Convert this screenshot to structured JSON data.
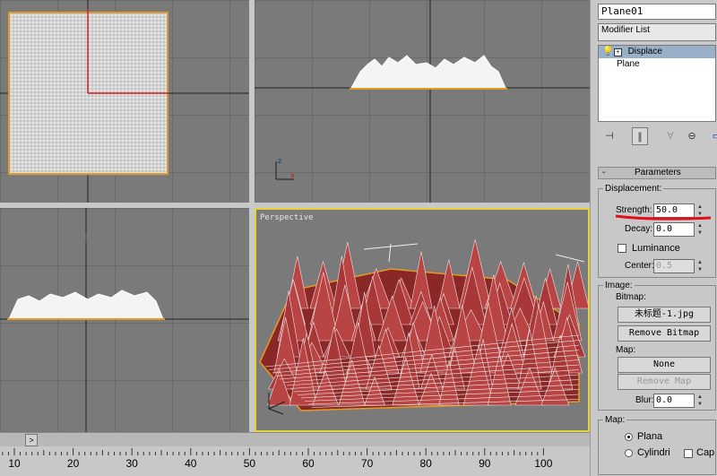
{
  "viewports": {
    "top": {
      "label": ""
    },
    "front": {
      "label": ""
    },
    "left": {
      "label": ""
    },
    "perspective": {
      "label": "Perspective"
    }
  },
  "panel": {
    "object_name": "Plane01",
    "modifier_list": "Modifier List",
    "stack": [
      {
        "label": "Displace",
        "selected": true
      },
      {
        "label": "Plane",
        "selected": false
      }
    ],
    "toolbar_icons": [
      "pin-icon",
      "show-end-result-icon",
      "make-unique-icon",
      "remove-modifier-icon",
      "configure-icon"
    ],
    "parameters_title": "Parameters",
    "displacement_group": "Displacement:",
    "strength_label": "Strength:",
    "strength_value": "50.0",
    "decay_label": "Decay:",
    "decay_value": "0.0",
    "luminance_label": "Luminance",
    "luminance_checked": false,
    "center_label": "Center:",
    "center_value": "0.5",
    "image_group": "Image:",
    "bitmap_label": "Bitmap:",
    "bitmap_button": "未标题-1.jpg",
    "remove_bitmap": "Remove Bitmap",
    "map_label": "Map:",
    "map_button": "None",
    "remove_map": "Remove Map",
    "blur_label": "Blur:",
    "blur_value": "0.0",
    "map_group": "Map:",
    "planar_label": "Plana",
    "cylindrical_label": "Cylindri",
    "cap_label": "Cap",
    "annotation_color": "#e0101a"
  },
  "timeline": {
    "track_button": ">",
    "ticks": [
      "10",
      "20",
      "30",
      "40",
      "50",
      "60",
      "70",
      "80",
      "90",
      "100"
    ]
  }
}
